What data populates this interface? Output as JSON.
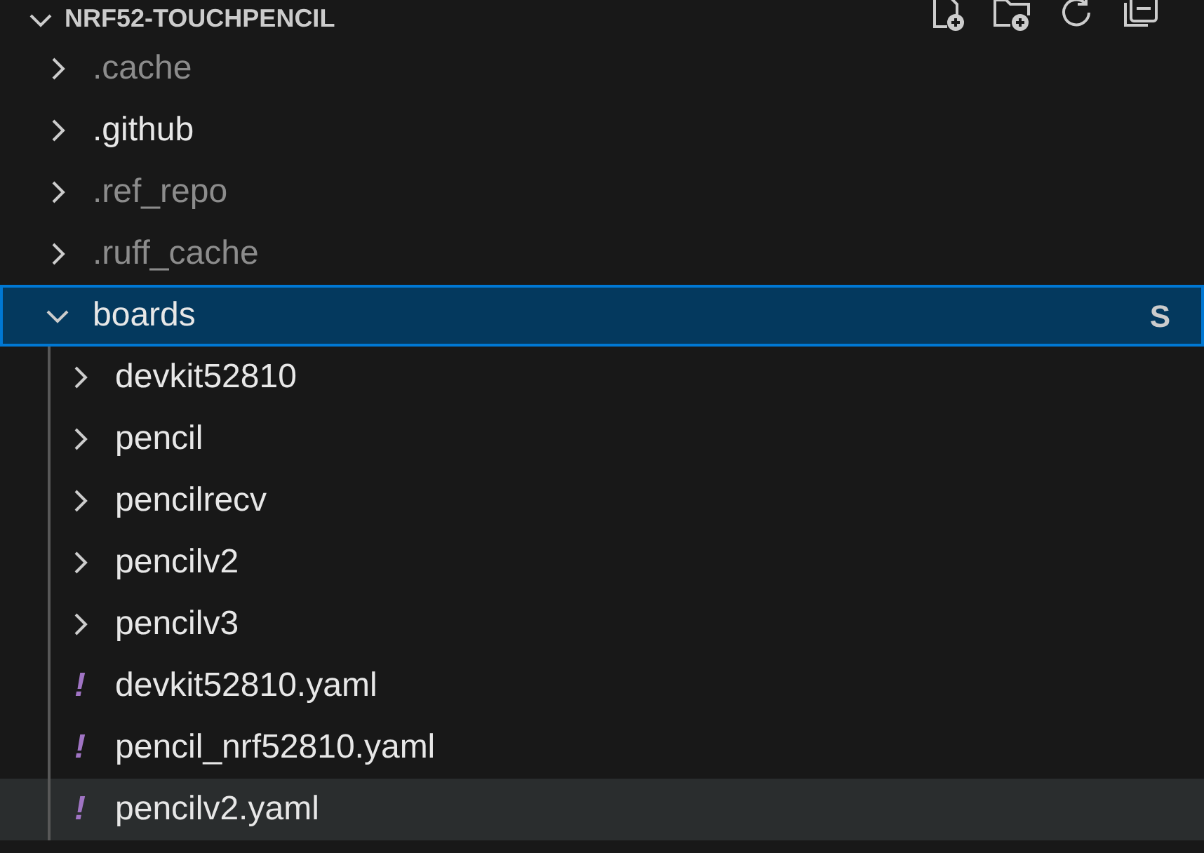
{
  "header": {
    "title": "NRF52-TOUCHPENCIL",
    "expanded": true
  },
  "tree": [
    {
      "kind": "folder",
      "label": ".cache",
      "dimmed": true,
      "expanded": false,
      "selected": false,
      "hovered": false
    },
    {
      "kind": "folder",
      "label": ".github",
      "dimmed": false,
      "expanded": false,
      "selected": false,
      "hovered": false
    },
    {
      "kind": "folder",
      "label": ".ref_repo",
      "dimmed": true,
      "expanded": false,
      "selected": false,
      "hovered": false
    },
    {
      "kind": "folder",
      "label": ".ruff_cache",
      "dimmed": true,
      "expanded": false,
      "selected": false,
      "hovered": false
    },
    {
      "kind": "folder",
      "label": "boards",
      "dimmed": false,
      "expanded": true,
      "selected": true,
      "hovered": false,
      "badge": "S",
      "children": [
        {
          "kind": "folder",
          "label": "devkit52810",
          "dimmed": false,
          "expanded": false,
          "selected": false,
          "hovered": false
        },
        {
          "kind": "folder",
          "label": "pencil",
          "dimmed": false,
          "expanded": false,
          "selected": false,
          "hovered": false
        },
        {
          "kind": "folder",
          "label": "pencilrecv",
          "dimmed": false,
          "expanded": false,
          "selected": false,
          "hovered": false
        },
        {
          "kind": "folder",
          "label": "pencilv2",
          "dimmed": false,
          "expanded": false,
          "selected": false,
          "hovered": false
        },
        {
          "kind": "folder",
          "label": "pencilv3",
          "dimmed": false,
          "expanded": false,
          "selected": false,
          "hovered": false
        },
        {
          "kind": "file",
          "icon": "!",
          "label": "devkit52810.yaml",
          "dimmed": false,
          "selected": false,
          "hovered": false
        },
        {
          "kind": "file",
          "icon": "!",
          "label": "pencil_nrf52810.yaml",
          "dimmed": false,
          "selected": false,
          "hovered": false
        },
        {
          "kind": "file",
          "icon": "!",
          "label": "pencilv2.yaml",
          "dimmed": false,
          "selected": false,
          "hovered": true
        }
      ]
    }
  ]
}
